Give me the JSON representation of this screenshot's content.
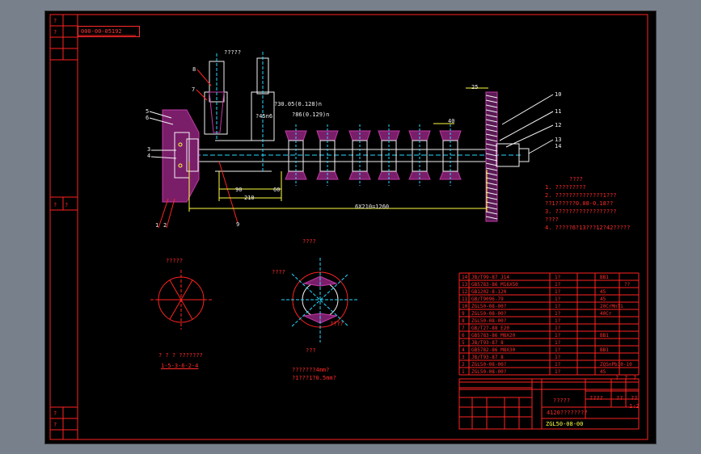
{
  "drawing_code_stamp": "000-00-05192",
  "dimensions": {
    "d25": "25",
    "d40": "40",
    "d90": "90",
    "d60": "60",
    "d210": "210",
    "chain": "6X210=1260",
    "tol1": "?30.05(0.128)n",
    "tol2": "?86(0.129)n",
    "tol3": "?45n6",
    "v_dim": "?????"
  },
  "balloons": [
    "1",
    "2",
    "3",
    "4",
    "5",
    "6",
    "7",
    "8",
    "9",
    "10",
    "11",
    "12",
    "13",
    "14"
  ],
  "tech_req": {
    "title": "????",
    "items": [
      "1. ?????????",
      "2. ??????????????1???",
      "   ??1??????0.08-0.18??",
      "3. ??????????????????",
      "   ????",
      "4. ?????6?13???12?42?????"
    ]
  },
  "left_view": {
    "label": "?????",
    "caption": "? ? ? ???????",
    "sequence": "1-5-3-6-2-4"
  },
  "mid_view": {
    "label": "????",
    "side_label": "????",
    "top_label": "????",
    "caption": "???",
    "note1": "???????4mm?",
    "note2": "?1???1?0.5mm?"
  },
  "bom_rows": [
    [
      "14",
      "JB/T99-87 J14",
      "1?",
      "",
      "BB1",
      ""
    ],
    [
      "13",
      "GB5783-86 M16X50",
      "1?",
      "",
      "",
      "??"
    ],
    [
      "12",
      "GB1202-8-120",
      "1?",
      "",
      "45",
      ""
    ],
    [
      "11",
      "GB/T9096-79",
      "1?",
      "",
      "45",
      ""
    ],
    [
      "10",
      "ZGL50-08-00?",
      "1?",
      "",
      "20CrMnTi",
      ""
    ],
    [
      "9",
      "ZGL50-08-00?",
      "1?",
      "",
      "40Cr",
      ""
    ],
    [
      "8",
      "ZGL50-08-00?",
      "1?",
      "",
      "",
      ""
    ],
    [
      "7",
      "GB/T27-88 E20",
      "1?",
      "",
      "",
      ""
    ],
    [
      "6",
      "GB5783-86 M8X20",
      "1?",
      "",
      "BB1",
      ""
    ],
    [
      "5",
      "JB/T93-87 8",
      "1?",
      "",
      "",
      ""
    ],
    [
      "4",
      "GB5782-86 M8X30",
      "1?",
      "",
      "BB1",
      ""
    ],
    [
      "3",
      "JB/T93-87 8",
      "1?",
      "",
      "",
      ""
    ],
    [
      "2",
      "ZGL50-08-00?",
      "1?",
      "",
      "ZQSnPb10-10",
      ""
    ],
    [
      "1",
      "ZGL50-08-00?",
      "1?",
      "",
      "45",
      ""
    ]
  ],
  "title_block": {
    "part_name": "?????",
    "subtitle": "4120????????",
    "drawing_no": "ZGL50-08-00",
    "scale_label": "????",
    "sheet_label": "??",
    "weight": "??",
    "ratio": "1:2",
    "qty_cols": [
      "?",
      "?",
      "?"
    ]
  },
  "left_strip": {
    "top_labels": [
      "?",
      "?",
      "?",
      "?"
    ],
    "mid_labels": [
      "?",
      "?"
    ],
    "bottom_labels": [
      "?",
      "?",
      "?"
    ]
  }
}
